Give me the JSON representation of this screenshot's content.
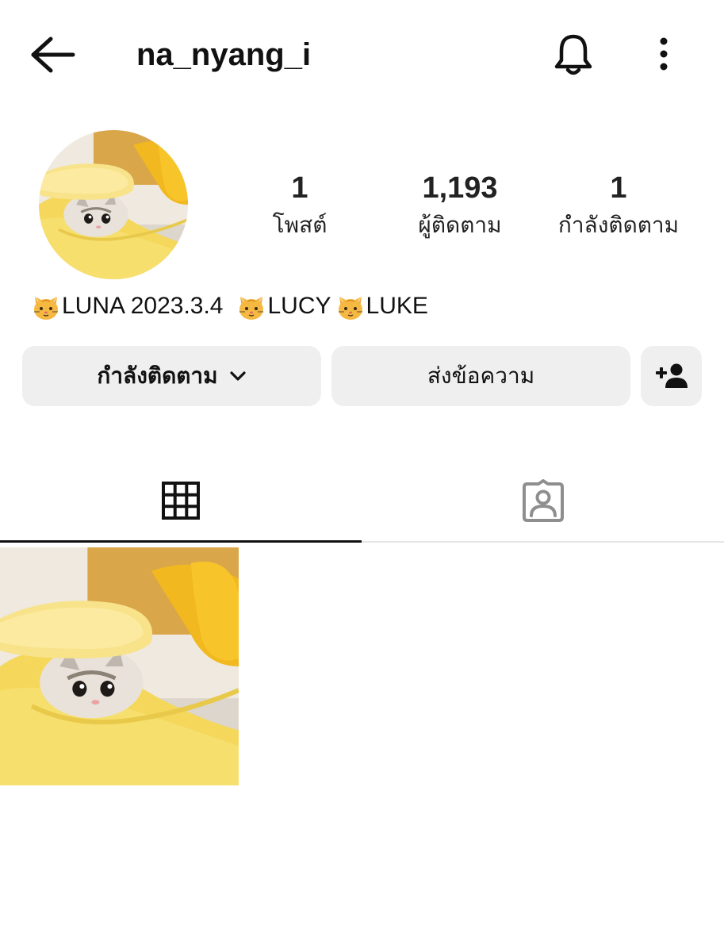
{
  "header": {
    "username": "na_nyang_i",
    "back_icon": "arrow-left-icon",
    "notification_icon": "bell-icon",
    "more_icon": "more-vertical-icon"
  },
  "profile": {
    "avatar_alt": "cat in banana bed",
    "stats": {
      "posts": {
        "value": "1",
        "label": "โพสต์"
      },
      "followers": {
        "value": "1,193",
        "label": "ผู้ติดตาม"
      },
      "following": {
        "value": "1",
        "label": "กำลังติดตาม"
      }
    },
    "bio": {
      "segments": [
        "LUNA 2023.3.4",
        "LUCY",
        "LUKE"
      ],
      "emoji": "cat-face-emoji"
    }
  },
  "actions": {
    "following_label": "กำลังติดตาม",
    "message_label": "ส่งข้อความ",
    "add_user_icon": "add-person-icon"
  },
  "tabs": [
    {
      "name": "posts-grid",
      "icon": "grid-icon",
      "active": true
    },
    {
      "name": "tagged",
      "icon": "tagged-person-icon",
      "active": false
    }
  ],
  "posts": [
    {
      "alt": "cat in banana bed"
    }
  ],
  "colors": {
    "button_bg": "#efefef",
    "text": "#111111",
    "tab_icon_inactive": "#8e8e8e",
    "banana_yellow": "#f7dc6f"
  }
}
